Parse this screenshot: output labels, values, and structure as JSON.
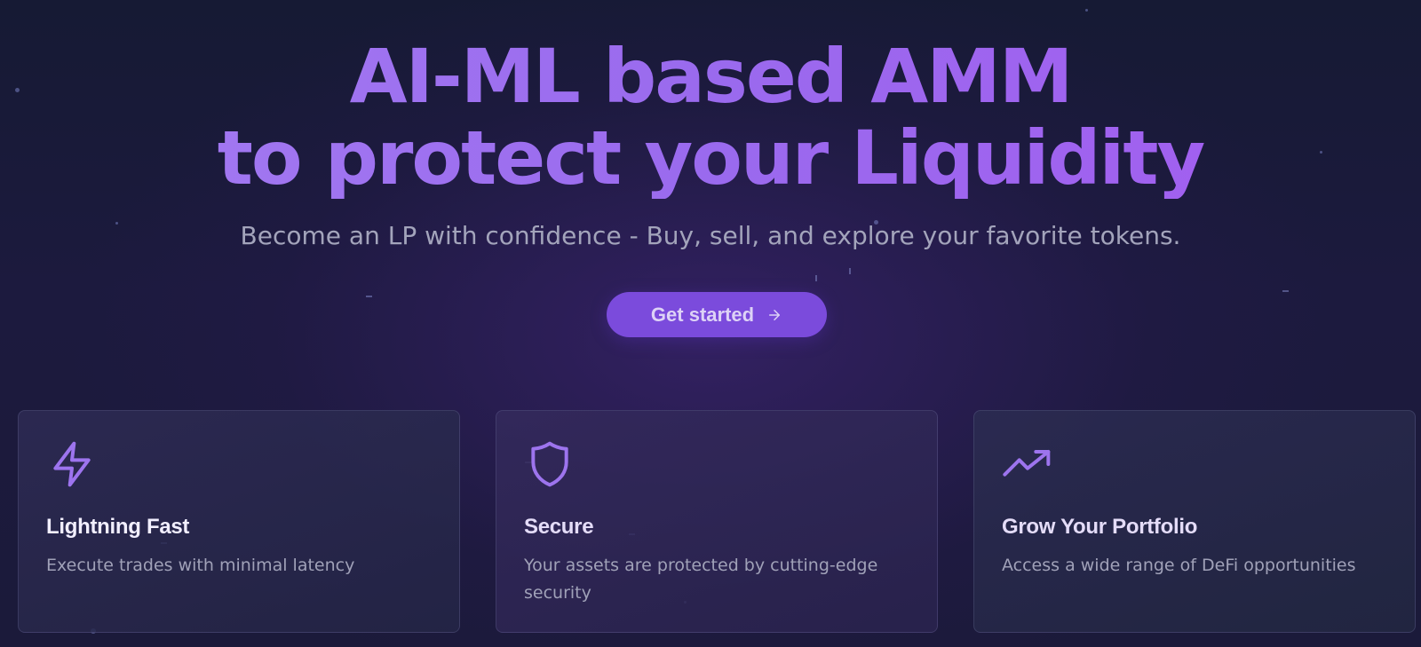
{
  "hero": {
    "headline_line1": "AI-ML based AMM",
    "headline_line2": "to protect your Liquidity",
    "subtitle": "Become an LP with confidence - Buy, sell, and explore your favorite tokens.",
    "cta_label": "Get started",
    "cta_icon": "arrow-right-icon"
  },
  "features": [
    {
      "icon": "lightning-bolt-icon",
      "title": "Lightning Fast",
      "description": "Execute trades with minimal latency"
    },
    {
      "icon": "shield-icon",
      "title": "Secure",
      "description": "Your assets are protected by cutting-edge security"
    },
    {
      "icon": "trending-up-icon",
      "title": "Grow Your Portfolio",
      "description": "Access a wide range of DeFi opportunities"
    }
  ],
  "colors": {
    "accent": "#9a6df0",
    "button": "#7b4bdc",
    "background": "#1b1a3a",
    "card_border": "#3d3d63"
  }
}
